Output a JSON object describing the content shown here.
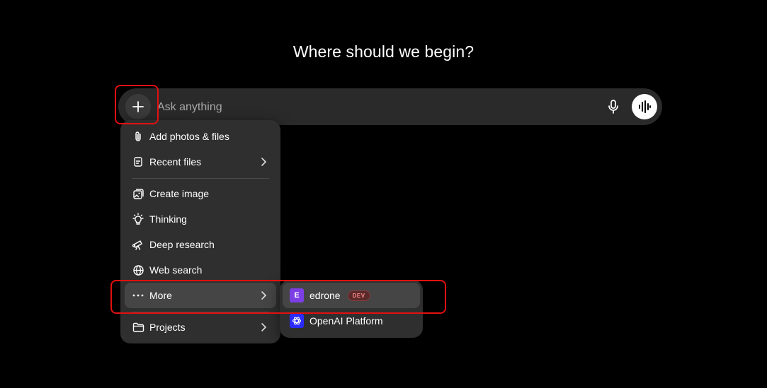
{
  "heading": "Where should we begin?",
  "composer": {
    "placeholder": "Ask anything",
    "plus_icon": "plus-icon",
    "mic_icon": "microphone-icon",
    "voice_icon": "voice-waveform-icon"
  },
  "menu": {
    "items": [
      {
        "label": "Add photos & files",
        "icon": "paperclip-icon"
      },
      {
        "label": "Recent files",
        "icon": "file-icon",
        "has_submenu": true
      },
      {
        "label": "Create image",
        "icon": "image-icon"
      },
      {
        "label": "Thinking",
        "icon": "lightbulb-icon"
      },
      {
        "label": "Deep research",
        "icon": "telescope-icon"
      },
      {
        "label": "Web search",
        "icon": "globe-icon"
      },
      {
        "label": "More",
        "icon": "ellipsis-icon",
        "has_submenu": true,
        "highlighted": true
      },
      {
        "label": "Projects",
        "icon": "folder-icon",
        "has_submenu": true
      }
    ]
  },
  "submenu": {
    "items": [
      {
        "label": "edrone",
        "icon_letter": "E",
        "badge": "DEV",
        "highlighted": true,
        "icon_color": "#7b3fe4"
      },
      {
        "label": "OpenAI Platform",
        "icon": "openai-logo-icon",
        "icon_color": "#2b2bff"
      }
    ]
  },
  "annotation_color": "#e21010"
}
